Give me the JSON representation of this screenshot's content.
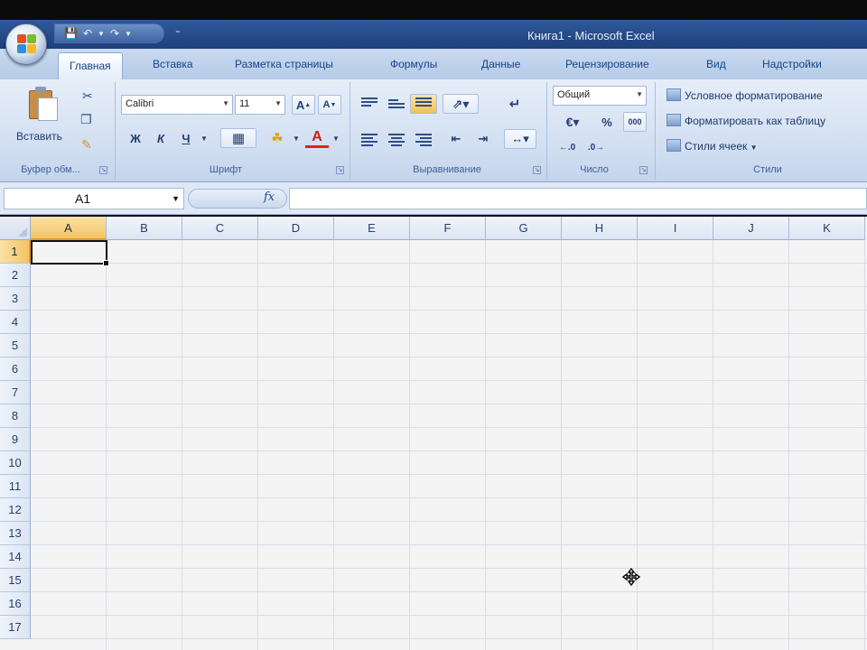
{
  "window": {
    "title": "Книга1 - Microsoft Excel",
    "qat_more": "⁼"
  },
  "tabs": [
    {
      "label": "Главная"
    },
    {
      "label": "Вставка"
    },
    {
      "label": "Разметка страницы"
    },
    {
      "label": "Формулы"
    },
    {
      "label": "Данные"
    },
    {
      "label": "Рецензирование"
    },
    {
      "label": "Вид"
    },
    {
      "label": "Надстройки"
    }
  ],
  "ribbon": {
    "clipboard": {
      "paste_label": "Вставить",
      "group_label": "Буфер обм..."
    },
    "font": {
      "font_name": "Calibri",
      "font_size": "11",
      "bold": "Ж",
      "italic": "К",
      "underline": "Ч",
      "font_color_glyph": "A",
      "grow_glyph": "A",
      "shrink_glyph": "A",
      "group_label": "Шрифт"
    },
    "alignment": {
      "group_label": "Выравнивание"
    },
    "number": {
      "format": "Общий",
      "percent": "%",
      "thousands": "000",
      "group_label": "Число"
    },
    "styles": {
      "conditional": "Условное форматирование",
      "format_table": "Форматировать как таблицу",
      "cell_styles": "Стили ячеек",
      "group_label": "Стили"
    }
  },
  "formula_bar": {
    "name_box": "A1",
    "fx": "fx",
    "value": ""
  },
  "sheet": {
    "columns": [
      "A",
      "B",
      "C",
      "D",
      "E",
      "F",
      "G",
      "H",
      "I",
      "J",
      "K"
    ],
    "rows": [
      "1",
      "2",
      "3",
      "4",
      "5",
      "6",
      "7",
      "8",
      "9",
      "10",
      "11",
      "12",
      "13",
      "14",
      "15",
      "16",
      "17"
    ],
    "active_cell": "A1",
    "selected_column": "A",
    "selected_row": "1"
  },
  "colors": {
    "title_bar": "#1e3f79",
    "ribbon": "#d1def1",
    "selection_header": "#f3c266",
    "grid_line": "#d7dde6"
  }
}
